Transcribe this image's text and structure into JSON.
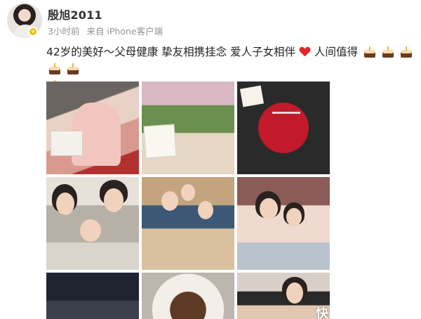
{
  "post": {
    "username": "殷旭2011",
    "time": "3小时前",
    "source": "来自 iPhone客户端",
    "text": "42岁的美好～父母健康 挚友相携挂念 爱人子女相伴",
    "text_after_heart": "人间值得",
    "emoji_cake_count": 6
  },
  "photos": [
    {
      "subject": "flower-bouquet-photo"
    },
    {
      "subject": "lotus-flowers-photo"
    },
    {
      "subject": "red-roses-crown-photo"
    },
    {
      "subject": "vintage-family-photo"
    },
    {
      "subject": "family-dinner-photo"
    },
    {
      "subject": "mother-daughter-photo"
    },
    {
      "subject": "stage-performance-photo"
    },
    {
      "subject": "cake-photo"
    },
    {
      "subject": "hug-photo"
    }
  ],
  "watermark": "快",
  "colors": {
    "username": "#333333",
    "meta": "#939393",
    "heart": "#e02a2a",
    "verify_badge": "#f5b800"
  }
}
